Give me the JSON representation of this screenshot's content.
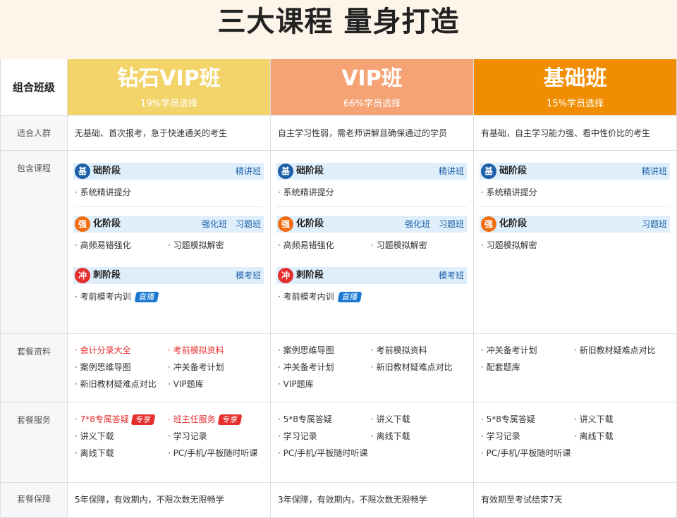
{
  "banner": {
    "title": "三大课程 量身打造"
  },
  "row_labels": {
    "combo": "组合班级",
    "audience": "适合人群",
    "courses": "包含课程",
    "materials": "套餐资料",
    "services": "套餐服务",
    "guarantee": "套餐保障"
  },
  "plans": [
    {
      "title": "钻石VIP班",
      "subtitle": "19%学员选择",
      "audience": "无基础、首次报考，急于快速通关的考生",
      "stages": [
        {
          "badge": "基",
          "name": "础阶段",
          "tags": [
            "精讲班"
          ],
          "items": [
            "· 系统精讲提分"
          ]
        },
        {
          "badge": "强",
          "name": "化阶段",
          "tags": [
            "强化班",
            "习题班"
          ],
          "items": [
            "· 高频易错强化",
            "· 习题模拟解密"
          ]
        },
        {
          "badge": "冲",
          "name": "刺阶段",
          "tags": [
            "模考班"
          ],
          "items": [
            "· 考前模考内训"
          ],
          "live_tag": "直播"
        }
      ],
      "materials": [
        "· 会计分录大全",
        "· 考前模拟资料",
        "· 案例思维导图",
        "· 冲关备考计划",
        "· 新旧教材疑难点对比",
        "· VIP题库"
      ],
      "services": [
        "· 7*8专属答疑",
        "· 班主任服务",
        "· 讲义下载",
        "· 学习记录",
        "· 离线下载",
        "· PC/手机/平板随时听课"
      ],
      "service_tag": "专享",
      "guarantee": "5年保障，有效期内，不限次数无限畅学"
    },
    {
      "title": "VIP班",
      "subtitle": "66%学员选择",
      "audience": "自主学习性弱，需老师讲解且确保通过的学员",
      "stages": [
        {
          "badge": "基",
          "name": "础阶段",
          "tags": [
            "精讲班"
          ],
          "items": [
            "· 系统精讲提分"
          ]
        },
        {
          "badge": "强",
          "name": "化阶段",
          "tags": [
            "强化班",
            "习题班"
          ],
          "items": [
            "· 高频易错强化",
            "· 习题模拟解密"
          ]
        },
        {
          "badge": "冲",
          "name": "刺阶段",
          "tags": [
            "模考班"
          ],
          "items": [
            "· 考前模考内训"
          ],
          "live_tag": "直播"
        }
      ],
      "materials": [
        "· 案例思维导图",
        "· 考前模拟资料",
        "· 冲关备考计划",
        "· 新旧教材疑难点对比",
        "· VIP题库"
      ],
      "services": [
        "· 5*8专属答疑",
        "· 讲义下载",
        "· 学习记录",
        "· 离线下载",
        "· PC/手机/平板随时听课"
      ],
      "guarantee": "3年保障，有效期内，不限次数无限畅学"
    },
    {
      "title": "基础班",
      "subtitle": "15%学员选择",
      "audience": "有基础，自主学习能力强、看中性价比的考生",
      "stages": [
        {
          "badge": "基",
          "name": "础阶段",
          "tags": [
            "精讲班"
          ],
          "items": [
            "· 系统精讲提分"
          ]
        },
        {
          "badge": "强",
          "name": "化阶段",
          "tags": [
            "习题班"
          ],
          "items": [
            "· 习题模拟解密"
          ]
        }
      ],
      "materials": [
        "· 冲关备考计划",
        "· 新旧教材疑难点对比",
        "· 配套题库"
      ],
      "services": [
        "· 5*8专属答疑",
        "· 讲义下载",
        "· 学习记录",
        "· 离线下载",
        "· PC/手机/平板随时听课"
      ],
      "guarantee": "有效期至考试结束7天"
    }
  ],
  "colors": {
    "diamond": "#f2d46b",
    "vip": "#f5a274",
    "basic": "#f18d00",
    "accent_blue": "#1c5ea8",
    "accent_red": "#e52f2f"
  }
}
